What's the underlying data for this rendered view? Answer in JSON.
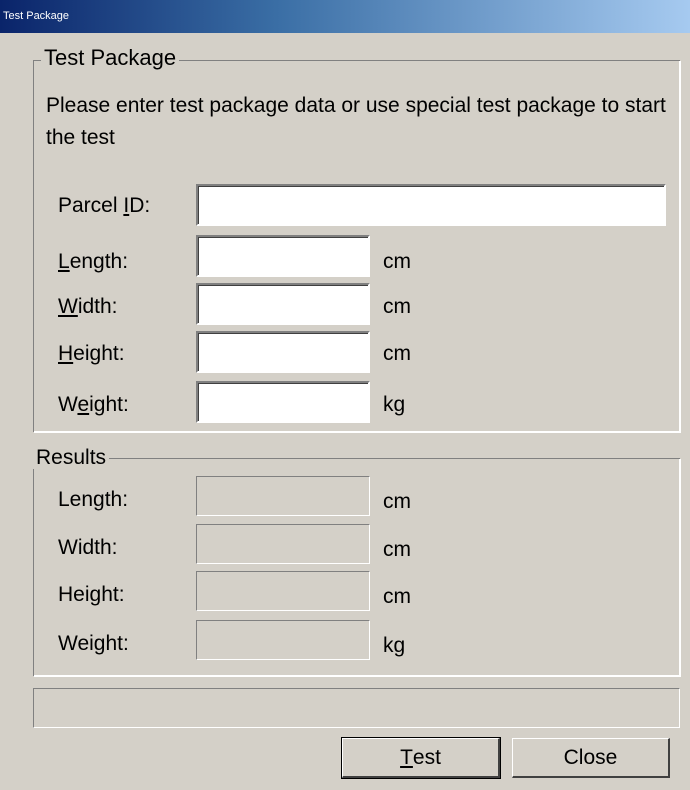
{
  "window": {
    "title": "Test Package"
  },
  "input_group": {
    "legend": "Test Package",
    "intro": "Please enter test package data or use special test package to start the test",
    "fields": [
      {
        "label_pre": "Parcel ",
        "mnemonic": "I",
        "label_post": "D:",
        "value": "",
        "unit": ""
      },
      {
        "label_pre": "",
        "mnemonic": "L",
        "label_post": "ength:",
        "value": "",
        "unit": "cm"
      },
      {
        "label_pre": "",
        "mnemonic": "W",
        "label_post": "idth:",
        "value": "",
        "unit": "cm"
      },
      {
        "label_pre": "",
        "mnemonic": "H",
        "label_post": "eight:",
        "value": "",
        "unit": "cm"
      },
      {
        "label_pre": "W",
        "mnemonic": "e",
        "label_post": "ight:",
        "value": "",
        "unit": "kg"
      }
    ]
  },
  "results_group": {
    "legend": "Results",
    "rows": [
      {
        "label": "Length:",
        "value": "",
        "unit": "cm"
      },
      {
        "label": "Width:",
        "value": "",
        "unit": "cm"
      },
      {
        "label": "Height:",
        "value": "",
        "unit": "cm"
      },
      {
        "label": "Weight:",
        "value": "",
        "unit": "kg"
      }
    ]
  },
  "status_text": "",
  "buttons": {
    "test": {
      "mnemonic": "T",
      "rest": "est"
    },
    "close": "Close"
  }
}
